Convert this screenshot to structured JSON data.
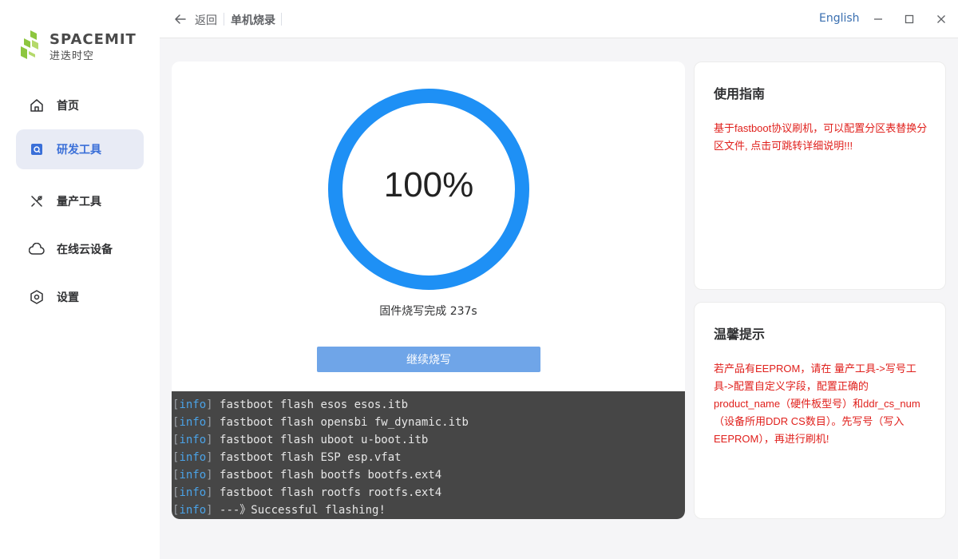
{
  "brand": {
    "name": "SPACEMIT",
    "subtitle": "进迭时空"
  },
  "sidebar": {
    "items": [
      {
        "label": "首页",
        "icon": "home-icon",
        "active": false
      },
      {
        "label": "研发工具",
        "icon": "dev-tools-icon",
        "active": true
      },
      {
        "label": "量产工具",
        "icon": "tools-icon",
        "active": false
      },
      {
        "label": "在线云设备",
        "icon": "cloud-icon",
        "active": false
      },
      {
        "label": "设置",
        "icon": "settings-icon",
        "active": false
      }
    ]
  },
  "topbar": {
    "back_label": "返回",
    "title": "单机烧录",
    "language": "English"
  },
  "progress": {
    "percent_label": "100%",
    "percent": 100,
    "status": "固件烧写完成 237s",
    "button_label": "继续烧写"
  },
  "log": {
    "lines": [
      {
        "level": "info",
        "text": "fastboot flash esos esos.itb"
      },
      {
        "level": "info",
        "text": "fastboot flash opensbi fw_dynamic.itb"
      },
      {
        "level": "info",
        "text": "fastboot flash uboot u-boot.itb"
      },
      {
        "level": "info",
        "text": "fastboot flash ESP esp.vfat"
      },
      {
        "level": "info",
        "text": "fastboot flash bootfs bootfs.ext4"
      },
      {
        "level": "info",
        "text": "fastboot flash rootfs rootfs.ext4"
      },
      {
        "level": "info",
        "text": "---》Successful flashing!"
      }
    ]
  },
  "guide": {
    "title": "使用指南",
    "body": "基于fastboot协议刷机，可以配置分区表替换分区文件, 点击可跳转详细说明!!!"
  },
  "tips": {
    "title": "温馨提示",
    "body": "若产品有EEPROM，请在 量产工具->写号工具->配置自定义字段，配置正确的product_name（硬件板型号）和ddr_cs_num（设备所用DDR CS数目）。先写号（写入EEPROM），再进行刷机!"
  },
  "colors": {
    "accent": "#1e90f5",
    "active_nav_bg": "#e8ebf5",
    "warning_text": "#e0201c",
    "log_bg": "#464646"
  }
}
